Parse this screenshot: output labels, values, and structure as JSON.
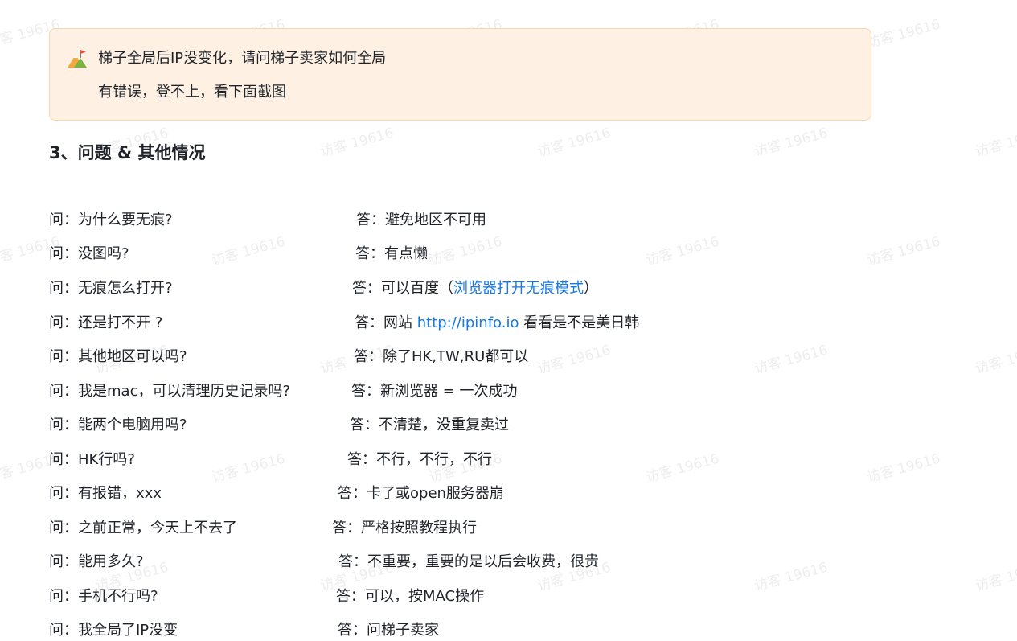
{
  "watermark_text": "访客 19616",
  "callout": {
    "icon": "mountain-flag-icon",
    "line1": "梯子全局后IP没变化，请问梯子卖家如何全局",
    "line2": "有错误，登不上，看下面截图"
  },
  "heading": "3、问题 & 其他情况",
  "qa": [
    {
      "q": "问：为什么要无痕?",
      "a_pre": "答：避免地区不可用",
      "link": "",
      "a_post": ""
    },
    {
      "q": "问：没图吗?",
      "a_pre": "答：有点懒",
      "link": "",
      "a_post": ""
    },
    {
      "q": "问：无痕怎么打开?",
      "a_pre": "答：可以百度（",
      "link": "浏览器打开无痕模式",
      "a_post": "）"
    },
    {
      "q": "问：还是打不开 ?",
      "a_pre": "答：网站 ",
      "link": "http://ipinfo.io",
      "a_post": " 看看是不是美日韩"
    },
    {
      "q": "问：其他地区可以吗?",
      "a_pre": "答：除了HK,TW,RU都可以",
      "link": "",
      "a_post": ""
    },
    {
      "q": "问：我是mac，可以清理历史记录吗?",
      "a_pre": "答：新浏览器 = 一次成功",
      "link": "",
      "a_post": ""
    },
    {
      "q": "问：能两个电脑用吗?",
      "a_pre": "答：不清楚，没重复卖过",
      "link": "",
      "a_post": ""
    },
    {
      "q": "问：HK行吗?",
      "a_pre": "答：不行，不行，不行",
      "link": "",
      "a_post": ""
    },
    {
      "q": "问：有报错，xxx",
      "a_pre": "答：卡了或open服务器崩",
      "link": "",
      "a_post": ""
    },
    {
      "q": "问：之前正常，今天上不去了",
      "a_pre": "答：严格按照教程执行",
      "link": "",
      "a_post": ""
    },
    {
      "q": "问：能用多久?",
      "a_pre": "答：不重要，重要的是以后会收费，很贵",
      "link": "",
      "a_post": ""
    },
    {
      "q": "问：手机不行吗?",
      "a_pre": "答：可以，按MAC操作",
      "link": "",
      "a_post": ""
    },
    {
      "q": "问：我全局了IP没变",
      "a_pre": "答：问梯子卖家",
      "link": "",
      "a_post": ""
    }
  ],
  "colors": {
    "callout_bg": "#fef1e3",
    "callout_border": "#f7d7ad",
    "link": "#1677e6",
    "text": "#1f2329"
  }
}
